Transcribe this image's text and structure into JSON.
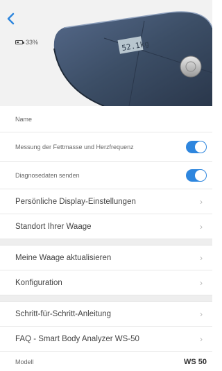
{
  "header": {
    "battery_text": "33%",
    "scale_display": "52.1kg"
  },
  "settings": {
    "name_label": "Name",
    "fat_label": "Messung der Fettmasse und Herzfrequenz",
    "diag_label": "Diagnosedaten senden",
    "display_label": "Persönliche Display-Einstellungen",
    "location_label": "Standort Ihrer Waage",
    "update_label": "Meine Waage aktualisieren",
    "config_label": "Konfiguration",
    "guide_label": "Schritt-für-Schritt-Anleitung",
    "faq_label": "FAQ - Smart Body Analyzer WS-50",
    "model_label": "Modell",
    "model_value": "WS 50"
  },
  "colors": {
    "accent": "#2e86de",
    "scale": "#3c4e66"
  },
  "icons": {
    "back": "chevron-left-icon",
    "battery": "battery-icon",
    "chevron": "chevron-right-icon"
  },
  "toggles": {
    "fat_enabled": true,
    "diag_enabled": true
  }
}
